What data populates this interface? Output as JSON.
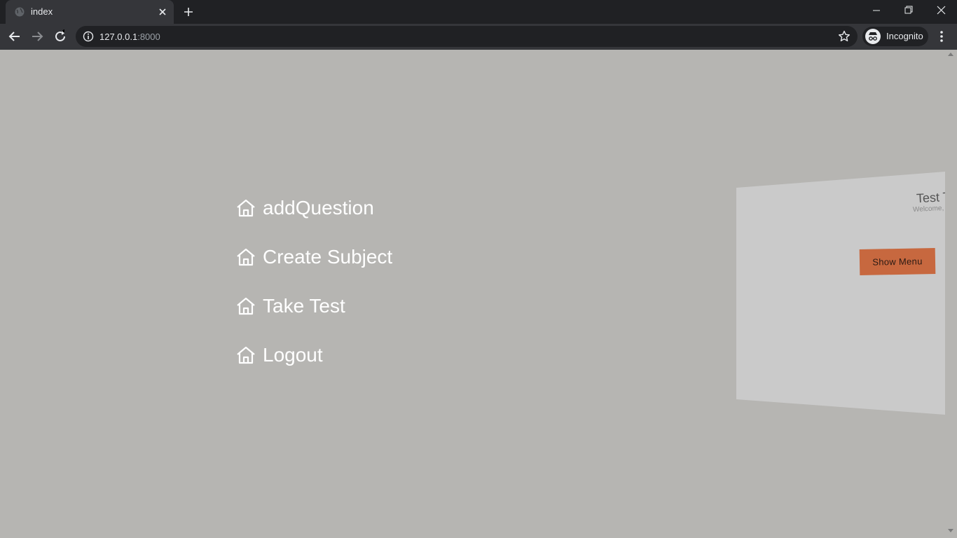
{
  "browser": {
    "tab_title": "index",
    "url_host": "127.0.0.1",
    "url_port": ":8000",
    "profile_label": "Incognito"
  },
  "nav_menu": {
    "items": [
      {
        "label": "addQuestion"
      },
      {
        "label": "Create Subject"
      },
      {
        "label": "Take Test"
      },
      {
        "label": "Logout"
      }
    ]
  },
  "page_panel": {
    "title": "Test T",
    "subtitle": "Welcome,",
    "show_menu_label": "Show Menu"
  },
  "colors": {
    "background": "#b6b5b2",
    "panel": "#cacaca",
    "accent_button": "#c7683f",
    "menu_text": "#ffffff"
  }
}
